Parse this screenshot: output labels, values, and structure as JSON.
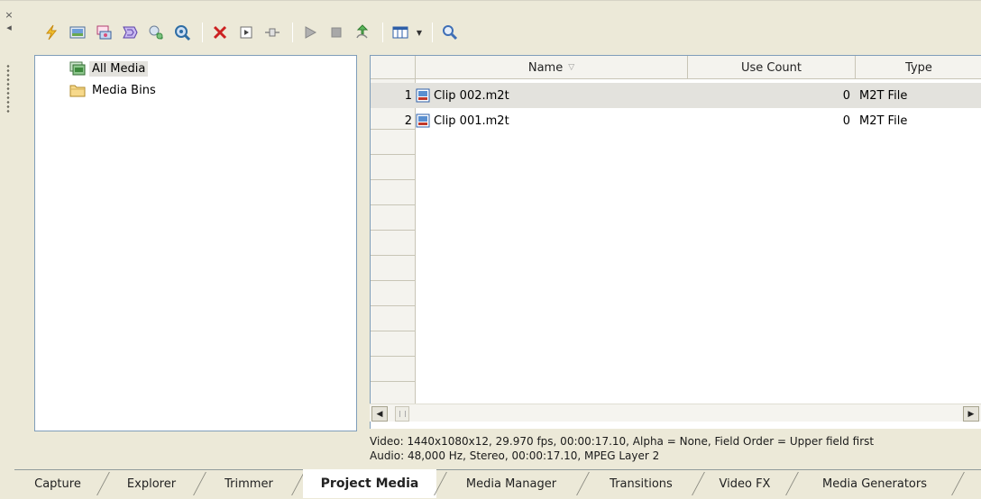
{
  "dock": {
    "close_glyph": "×",
    "collapse_glyph": "◂"
  },
  "toolbar": {
    "buttons": [
      {
        "name": "import-media-icon",
        "color": "#e5a31c"
      },
      {
        "name": "capture-video-icon",
        "color": "#4a7fbf"
      },
      {
        "name": "get-media-from-web-icon",
        "color": "#d94f7b"
      },
      {
        "name": "extract-audio-icon",
        "color": "#7a5fc7"
      },
      {
        "name": "get-photos-icon",
        "color": "#4fa35b"
      },
      {
        "name": "media-properties-icon",
        "color": "#2e6da4"
      },
      {
        "name": "remove-icon",
        "color": "#cc2222"
      },
      {
        "name": "media-fx-icon",
        "color": "#4a4a4a"
      },
      {
        "name": "media-plugin-icon",
        "color": "#6d6d6d"
      },
      {
        "name": "start-preview-icon",
        "color": "#9a9a9a"
      },
      {
        "name": "stop-preview-icon",
        "color": "#9a9a9a"
      },
      {
        "name": "auto-preview-icon",
        "color": "#3b8f3b"
      },
      {
        "name": "views-icon",
        "color": "#2e5fa8"
      },
      {
        "name": "search-icon",
        "color": "#3f6fb6"
      }
    ]
  },
  "tree": {
    "items": [
      {
        "label": "All Media",
        "selected": true,
        "icon": "all-media-icon"
      },
      {
        "label": "Media Bins",
        "selected": false,
        "icon": "folder-icon"
      }
    ]
  },
  "list": {
    "columns": [
      "Name",
      "Use Count",
      "Type"
    ],
    "sort_glyph": "▽",
    "rows": [
      {
        "num": "1",
        "name": "Clip 002.m2t",
        "count": "0",
        "type": "M2T File",
        "selected": true
      },
      {
        "num": "2",
        "name": "Clip 001.m2t",
        "count": "0",
        "type": "M2T File",
        "selected": false
      }
    ]
  },
  "scrollbar": {
    "left_glyph": "◀",
    "right_glyph": "▶"
  },
  "info": {
    "video": "Video: 1440x1080x12, 29.970 fps, 00:00:17.10, Alpha = None, Field Order = Upper field first",
    "audio": "Audio: 48,000 Hz, Stereo, 00:00:17.10, MPEG Layer 2"
  },
  "tabs": [
    {
      "label": "Capture",
      "active": false
    },
    {
      "label": "Explorer",
      "active": false
    },
    {
      "label": "Trimmer",
      "active": false
    },
    {
      "label": "Project Media",
      "active": true
    },
    {
      "label": "Media Manager",
      "active": false
    },
    {
      "label": "Transitions",
      "active": false
    },
    {
      "label": "Video FX",
      "active": false
    },
    {
      "label": "Media Generators",
      "active": false
    }
  ]
}
